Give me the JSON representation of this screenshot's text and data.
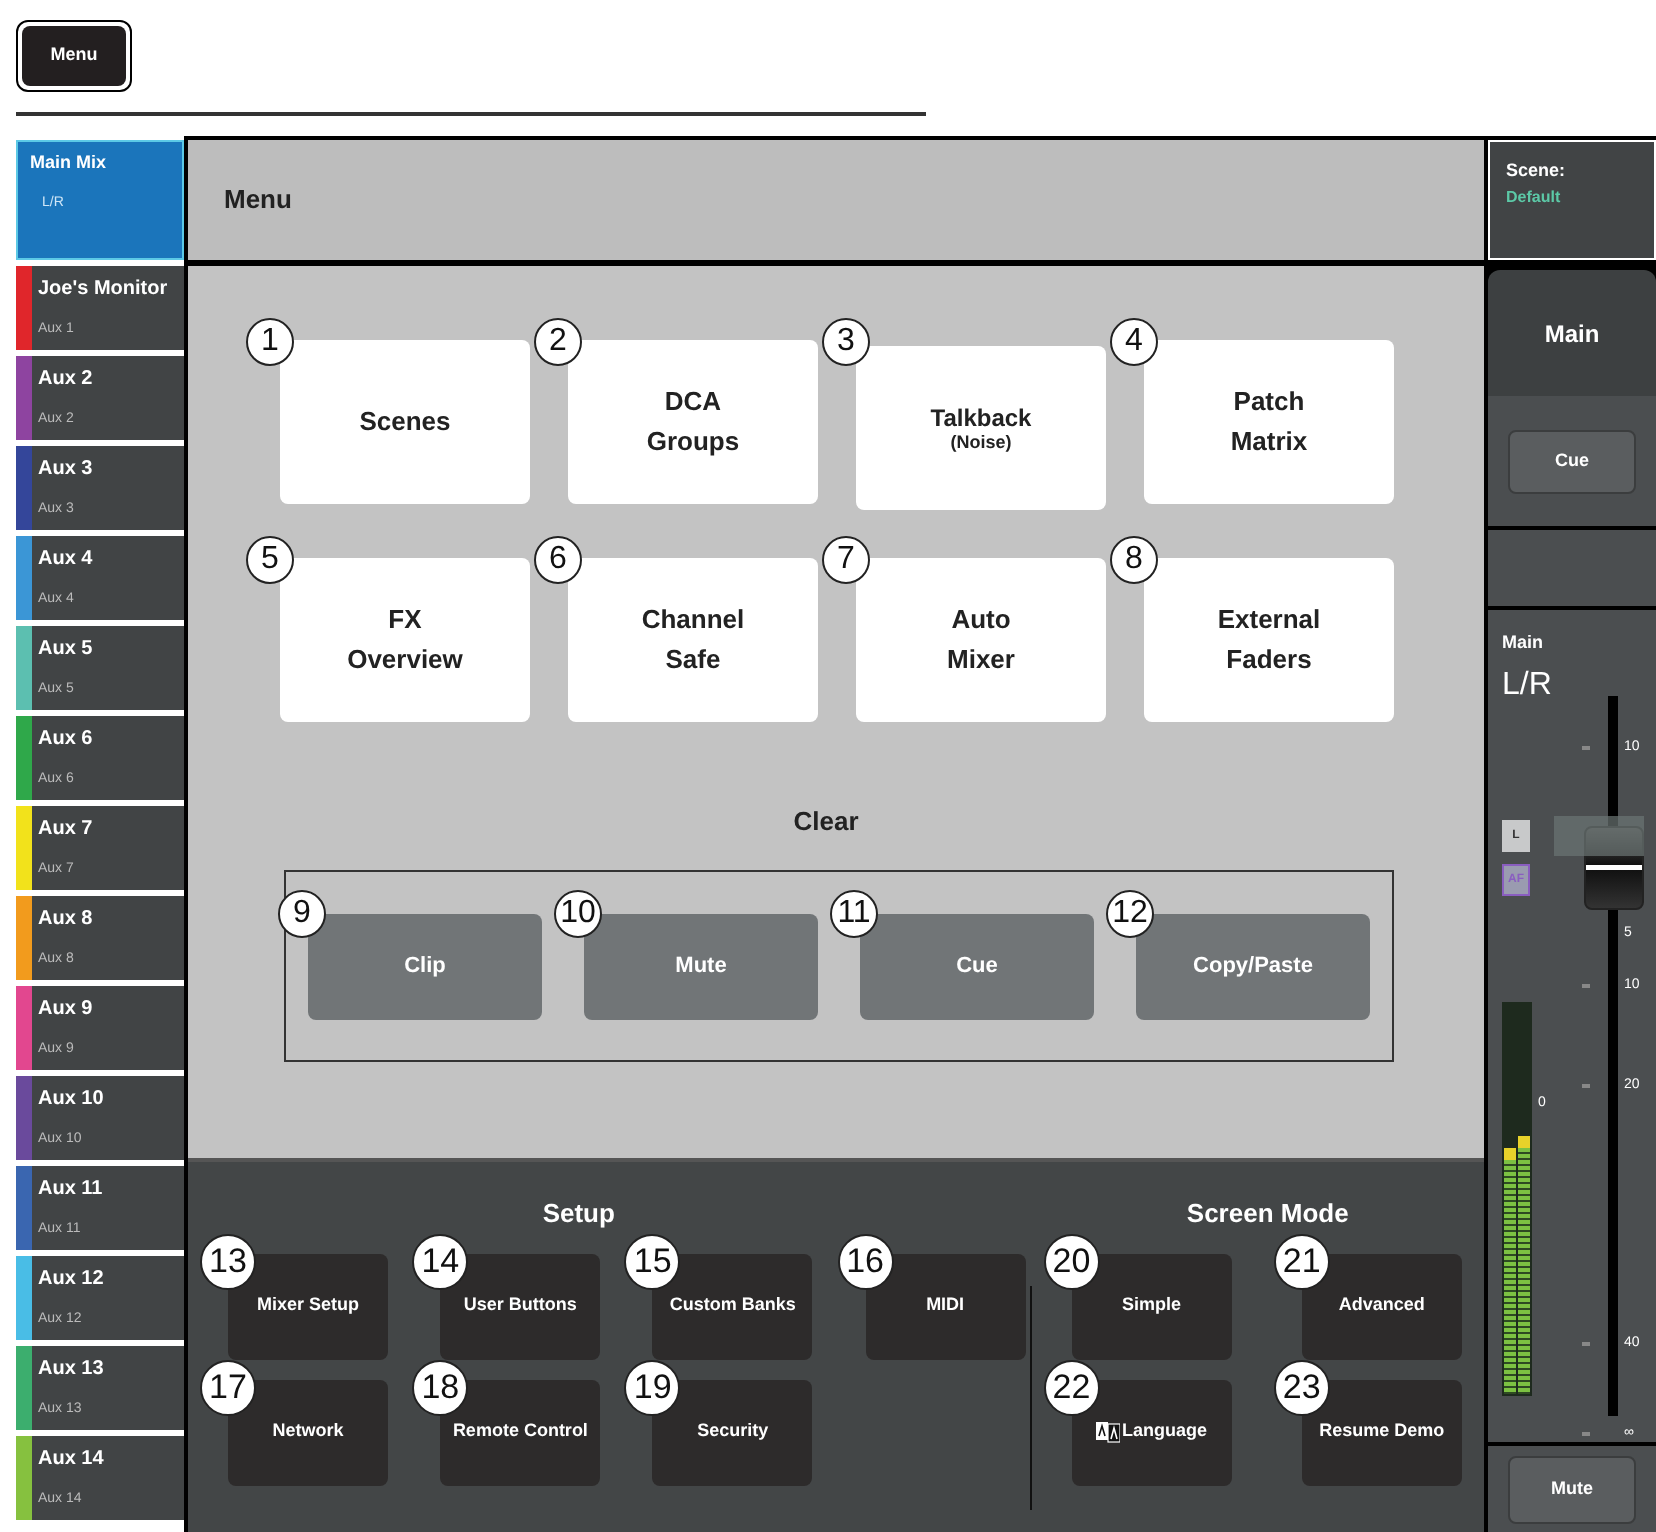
{
  "top_button": {
    "label": "Menu"
  },
  "sidebar": {
    "items": [
      {
        "name": "Main Mix",
        "sub": "L/R",
        "selected": true,
        "color": "#1b75bb"
      },
      {
        "name": "Joe's Monitor",
        "sub": "Aux 1",
        "selected": false,
        "color": "#e0262b"
      },
      {
        "name": "Aux 2",
        "sub": "Aux 2",
        "selected": false,
        "color": "#8e44a0"
      },
      {
        "name": "Aux 3",
        "sub": "Aux 3",
        "selected": false,
        "color": "#34469a"
      },
      {
        "name": "Aux 4",
        "sub": "Aux 4",
        "selected": false,
        "color": "#3b96d6"
      },
      {
        "name": "Aux 5",
        "sub": "Aux 5",
        "selected": false,
        "color": "#5cbfb0"
      },
      {
        "name": "Aux 6",
        "sub": "Aux 6",
        "selected": false,
        "color": "#2fa84a"
      },
      {
        "name": "Aux 7",
        "sub": "Aux 7",
        "selected": false,
        "color": "#f2e21b"
      },
      {
        "name": "Aux 8",
        "sub": "Aux 8",
        "selected": false,
        "color": "#f29b1d"
      },
      {
        "name": "Aux 9",
        "sub": "Aux 9",
        "selected": false,
        "color": "#e2478f"
      },
      {
        "name": "Aux 10",
        "sub": "Aux 10",
        "selected": false,
        "color": "#6a4a9c"
      },
      {
        "name": "Aux 11",
        "sub": "Aux 11",
        "selected": false,
        "color": "#3a66b0"
      },
      {
        "name": "Aux 12",
        "sub": "Aux 12",
        "selected": false,
        "color": "#49bde6"
      },
      {
        "name": "Aux 13",
        "sub": "Aux 13",
        "selected": false,
        "color": "#3cae6e"
      },
      {
        "name": "Aux 14",
        "sub": "Aux 14",
        "selected": false,
        "color": "#86c13f"
      }
    ]
  },
  "header": {
    "title": "Menu"
  },
  "menu_buttons": [
    {
      "number": "1",
      "label": "Scenes"
    },
    {
      "number": "2",
      "label": "DCA\nGroups"
    },
    {
      "number": "3",
      "label": "Talkback",
      "sub": "(Noise)"
    },
    {
      "number": "4",
      "label": "Patch\nMatrix"
    },
    {
      "number": "5",
      "label": "FX\nOverview"
    },
    {
      "number": "6",
      "label": "Channel\nSafe"
    },
    {
      "number": "7",
      "label": "Auto\nMixer"
    },
    {
      "number": "8",
      "label": "External\nFaders"
    }
  ],
  "clear": {
    "title": "Clear",
    "buttons": [
      {
        "number": "9",
        "label": "Clip"
      },
      {
        "number": "10",
        "label": "Mute"
      },
      {
        "number": "11",
        "label": "Cue"
      },
      {
        "number": "12",
        "label": "Copy/Paste"
      }
    ]
  },
  "setup": {
    "title": "Setup",
    "buttons": [
      {
        "number": "13",
        "label": "Mixer Setup"
      },
      {
        "number": "14",
        "label": "User Buttons"
      },
      {
        "number": "15",
        "label": "Custom Banks"
      },
      {
        "number": "16",
        "label": "MIDI"
      },
      {
        "number": "17",
        "label": "Network"
      },
      {
        "number": "18",
        "label": "Remote Control"
      },
      {
        "number": "19",
        "label": "Security"
      }
    ]
  },
  "screen_mode": {
    "title": "Screen Mode",
    "buttons": [
      {
        "number": "20",
        "label": "Simple"
      },
      {
        "number": "21",
        "label": "Advanced"
      },
      {
        "number": "22",
        "label": "Language",
        "kind": "language"
      },
      {
        "number": "23",
        "label": "Resume Demo"
      }
    ]
  },
  "scene": {
    "label": "Scene:",
    "value": "Default"
  },
  "channel": {
    "title": "Main",
    "cue": "Cue",
    "name": "Main",
    "bus": "L/R",
    "l_button": "L",
    "af_button": "AF",
    "meter_label": "0",
    "scale": [
      "10",
      "5",
      "10",
      "20",
      "40",
      "∞"
    ],
    "fader": {
      "level": 0.76
    },
    "meters": [
      {
        "level": 0.63
      },
      {
        "level": 0.66
      }
    ],
    "mute": "Mute"
  }
}
